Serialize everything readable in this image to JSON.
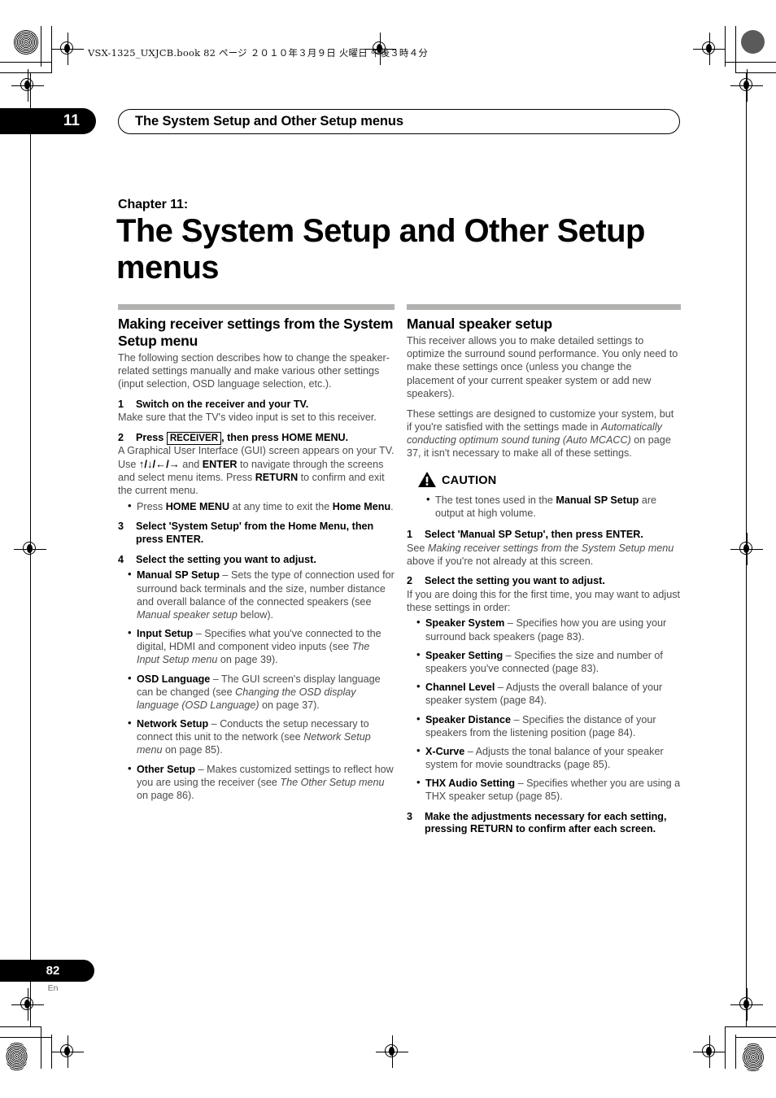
{
  "print_info": {
    "file_line": "VSX-1325_UXJCB.book   82 ページ   ２０１０年３月９日   火曜日   午後３時４分"
  },
  "header": {
    "chapter_number": "11",
    "title": "The System Setup and Other Setup menus"
  },
  "chapter": {
    "label": "Chapter 11:",
    "title": "The System Setup and Other Setup menus"
  },
  "left_column": {
    "section_title": "Making receiver settings from the System Setup menu",
    "intro": "The following section describes how to change the speaker-related settings manually and make various other settings (input selection, OSD language selection, etc.).",
    "steps": [
      {
        "number": "1",
        "heading": "Switch on the receiver and your TV.",
        "body": "Make sure that the TV's video input is set to this receiver."
      },
      {
        "number": "2",
        "heading_pre": "Press ",
        "heading_key": "RECEIVER",
        "heading_post": ", then press HOME MENU.",
        "body_1": "A Graphical User Interface (GUI) screen appears on your TV. Use ",
        "body_arrows": "↑/↓/←/→",
        "body_2": " and ",
        "body_enter": "ENTER",
        "body_3": " to navigate through the screens and select menu items. Press ",
        "body_return": "RETURN",
        "body_4": " to confirm and exit the current menu.",
        "bullet_1_pre": "Press ",
        "bullet_1_key": "HOME MENU",
        "bullet_1_mid": " at any time to exit the ",
        "bullet_1_key2": "Home Menu",
        "bullet_1_post": "."
      },
      {
        "number": "3",
        "heading": "Select 'System Setup' from the Home Menu, then press ENTER."
      },
      {
        "number": "4",
        "heading": "Select the setting you want to adjust."
      }
    ],
    "settings": [
      {
        "name": "Manual SP Setup",
        "dash": " – ",
        "text_1": "Sets the type of connection used for surround back terminals and the size, number distance and overall balance of the connected speakers (see ",
        "italic": "Manual speaker setup",
        "text_2": " below)."
      },
      {
        "name": "Input Setup",
        "dash": " – ",
        "text_1": "Specifies what you've connected to the digital, HDMI and component video inputs (see ",
        "italic": "The Input Setup menu",
        "text_2": " on page 39)."
      },
      {
        "name": "OSD Language",
        "dash": " – ",
        "text_1": "The GUI screen's display language can be changed (see ",
        "italic": "Changing the OSD display language (OSD Language)",
        "text_2": " on page 37)."
      },
      {
        "name": "Network Setup",
        "dash": " – ",
        "text_1": "Conducts the setup necessary to connect this unit to the network (see ",
        "italic": "Network Setup menu",
        "text_2": " on page 85)."
      },
      {
        "name": "Other Setup",
        "dash": " – ",
        "text_1": "Makes customized settings to reflect how you are using the receiver (see ",
        "italic": "The Other Setup menu",
        "text_2": " on page 86)."
      }
    ]
  },
  "right_column": {
    "section_title": "Manual speaker setup",
    "intro_1": "This receiver allows you to make detailed settings to optimize the surround sound performance. You only need to make these settings once (unless you change the placement of your current speaker system or add new speakers).",
    "intro_2_pre": "These settings are designed to customize your system, but if you're satisfied with the settings made in ",
    "intro_2_italic": "Automatically conducting optimum sound tuning (Auto MCACC)",
    "intro_2_post": " on page 37, it isn't necessary to make all of these settings.",
    "caution": {
      "label": "CAUTION",
      "bullet_pre": "The test tones used in the ",
      "bullet_bold": "Manual SP Setup",
      "bullet_post": " are output at high volume."
    },
    "steps": [
      {
        "number": "1",
        "heading": "Select 'Manual SP Setup', then press ENTER.",
        "body_pre": "See ",
        "body_italic": "Making receiver settings from the System Setup menu",
        "body_post": " above if you're not already at this screen."
      },
      {
        "number": "2",
        "heading": "Select the setting you want to adjust.",
        "body": "If you are doing this for the first time, you may want to adjust these settings in order:"
      },
      {
        "number": "3",
        "heading": "Make the adjustments necessary for each setting, pressing RETURN to confirm after each screen."
      }
    ],
    "settings": [
      {
        "name": "Speaker System",
        "dash": " – ",
        "text": "Specifies how you are using your surround back speakers (page 83)."
      },
      {
        "name": "Speaker Setting",
        "dash": " – ",
        "text": "Specifies the size and number of speakers you've connected (page 83)."
      },
      {
        "name": "Channel Level",
        "dash": " – ",
        "text": "Adjusts the overall balance of your speaker system (page 84)."
      },
      {
        "name": "Speaker Distance",
        "dash": " – ",
        "text": "Specifies the distance of your speakers from the listening position (page 84)."
      },
      {
        "name": "X-Curve",
        "dash": " – ",
        "text": "Adjusts the tonal balance of your speaker system for movie soundtracks (page 85)."
      },
      {
        "name": "THX Audio Setting",
        "dash": " – ",
        "text": "Specifies whether you are using a THX speaker setup (page 85)."
      }
    ]
  },
  "footer": {
    "page_number": "82",
    "language_code": "En"
  },
  "colors": {
    "rule_gray": "#b1b1af",
    "body_gray": "#4b4b4b",
    "ink_black": "#000000"
  }
}
